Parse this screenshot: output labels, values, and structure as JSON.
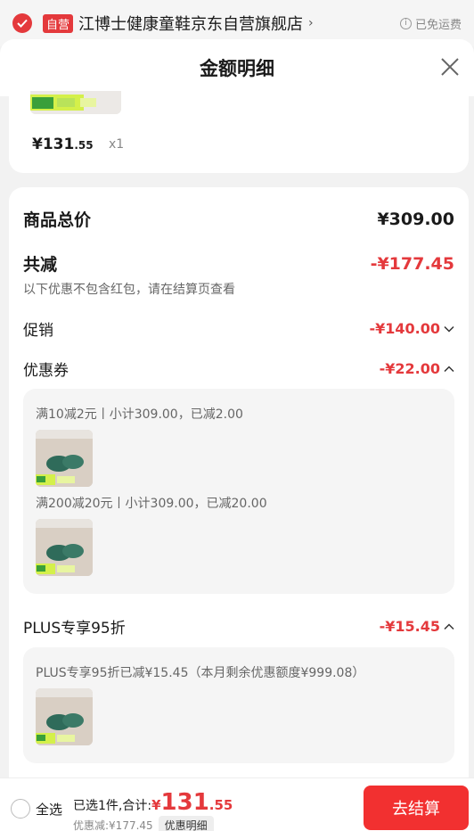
{
  "topbar": {
    "self_badge": "自营",
    "shop_name": "江博士健康童鞋京东自营旗舰店",
    "chevron": "›",
    "free_shipping": "已免运费",
    "info_icon": "i"
  },
  "sheet": {
    "title": "金额明细"
  },
  "item": {
    "price_int": "¥131",
    "price_dec": ".55",
    "qty": "x1"
  },
  "summary": {
    "total_label": "商品总价",
    "total_value": "¥309.00",
    "reduce_label": "共减",
    "reduce_value": "-¥177.45",
    "note": "以下优惠不包含红包，请在结算页查看",
    "promo_label": "促销",
    "promo_value": "-¥140.00",
    "coupon_label": "优惠券",
    "coupon_value": "-¥22.00",
    "coupons": [
      {
        "text": "满10减2元丨小计309.00，已减2.00"
      },
      {
        "text": "满200减20元丨小计309.00，已减20.00"
      }
    ],
    "plus_label": "PLUS专享95折",
    "plus_value": "-¥15.45",
    "plus_note": "PLUS专享95折已减¥15.45（本月剩余优惠额度¥999.08）"
  },
  "bottom": {
    "select_all": "全选",
    "selected_text": "已选1件,合计:",
    "total_yen": "¥",
    "total_int": "131",
    "total_dec": ".55",
    "discount_text": "优惠减:¥177.45",
    "detail_chip": "优惠明细",
    "checkout": "去结算"
  },
  "colors": {
    "accent": "#e4393c",
    "checkout": "#f23030"
  }
}
